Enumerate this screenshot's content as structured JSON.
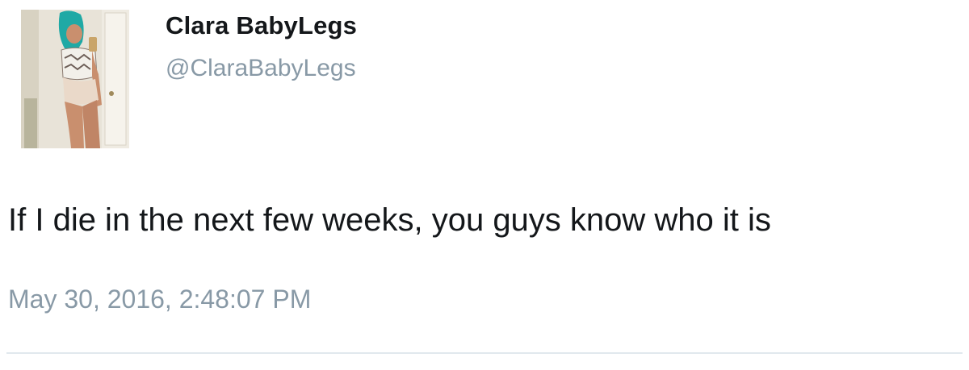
{
  "user": {
    "display_name": "Clara BabyLegs",
    "handle": "@ClaraBabyLegs",
    "avatar": "profile-photo"
  },
  "tweet": {
    "text": "If I die in the next few weeks, you guys know who it is",
    "timestamp": "May 30, 2016, 2:48:07 PM"
  },
  "colors": {
    "name": "#14171a",
    "secondary_text": "#8899a6",
    "divider": "#e1e8ed",
    "background": "#ffffff"
  }
}
